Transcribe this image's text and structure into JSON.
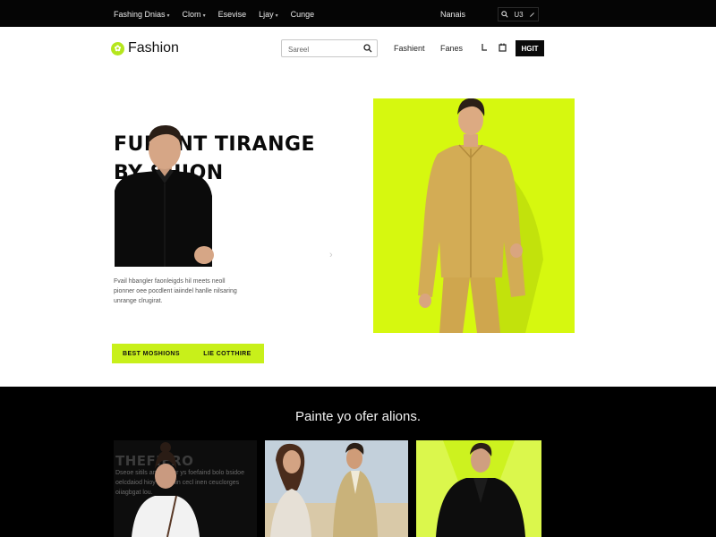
{
  "topbar": {
    "nav": [
      {
        "label": "Fashing Dnias",
        "dropdown": true
      },
      {
        "label": "Clom",
        "dropdown": true
      },
      {
        "label": "Esevise",
        "dropdown": false
      },
      {
        "label": "Ljay",
        "dropdown": true
      },
      {
        "label": "Cunge",
        "dropdown": false
      }
    ],
    "right_label": "Nanais",
    "icons": [
      "search-icon",
      "user-icon",
      "edit-icon"
    ],
    "icon_text": "U3"
  },
  "header": {
    "logo_text": "Fashion",
    "search_placeholder": "Sareel",
    "nav": [
      "Fashient",
      "Fanes"
    ],
    "icons": [
      "bag-icon",
      "cart-icon"
    ],
    "cta_label": "HGIT"
  },
  "hero": {
    "title_line1": "FUNANT TIRANGE",
    "title_line2": "BY SHION",
    "body_text": "Fvail hbangler faonleigds hil meets neoll pionner oee pocdlent iaiindel hanlle nilsaring unrange clrugirat.",
    "btn_primary": "BEST MOSHIONS",
    "btn_secondary": "LIE COTTHIRE",
    "accent_color": "#d6f80f"
  },
  "feature": {
    "title": "Painte yo ofer alions.",
    "cards": [
      {
        "title": "THEFIERO",
        "text": "Dseoe sitils ano sieirer ys foefaind bolo bsidoe oelcdaiod hioy coalenin cecl inen ceuclorges oiiagbgat lou."
      },
      {
        "title": "",
        "text": ""
      },
      {
        "title": "",
        "text": ""
      }
    ]
  }
}
